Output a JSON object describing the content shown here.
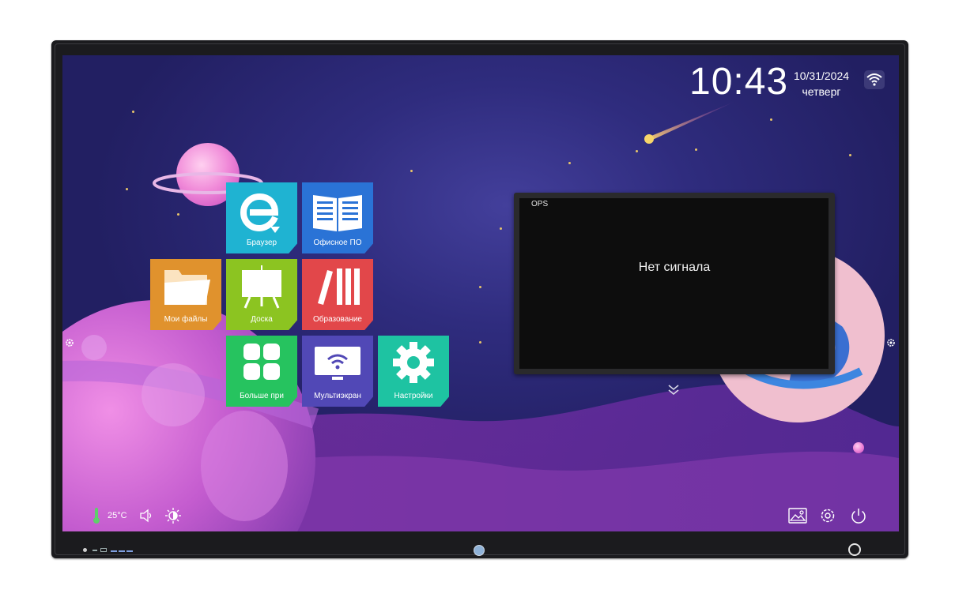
{
  "status": {
    "time": "10:43",
    "date": "10/31/2024",
    "weekday": "четверг",
    "temperature": "25°C"
  },
  "apps": [
    {
      "label": "Браузер",
      "color": "#1fb3d2",
      "icon": "browser-e-icon"
    },
    {
      "label": "Офисное ПО",
      "color": "#2a73d6",
      "icon": "book-icon"
    },
    {
      "label": "Мои файлы",
      "color": "#e0922d",
      "icon": "folder-icon"
    },
    {
      "label": "Доска",
      "color": "#8cc421",
      "icon": "whiteboard-icon"
    },
    {
      "label": "Образование",
      "color": "#e2474a",
      "icon": "books-icon"
    },
    {
      "label": "Больше при",
      "color": "#26c35f",
      "icon": "grid-icon"
    },
    {
      "label": "Мультиэкран",
      "color": "#5148b6",
      "icon": "screen-share-icon"
    },
    {
      "label": "Настройки",
      "color": "#1ec3a2",
      "icon": "gear-icon"
    }
  ],
  "source_window": {
    "title": "OPS",
    "message": "Нет сигнала"
  },
  "icons": {
    "side_left": "gear-icon",
    "side_right": "gear-icon",
    "thermometer": "thermometer-icon",
    "volume": "volume-icon",
    "brightness": "brightness-icon",
    "wallpaper": "image-icon",
    "settings": "gear-icon",
    "power": "power-icon",
    "expand": "double-chevron-down-icon",
    "wifi": "wifi-icon"
  }
}
